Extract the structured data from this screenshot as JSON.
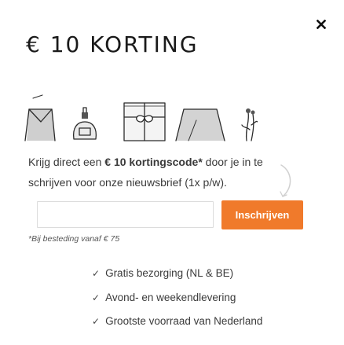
{
  "popup": {
    "close_icon": "close-icon",
    "title": "€ 10 KORTING",
    "illustration": "gift-items-illustration",
    "lead_pre": "Krijg direct een ",
    "lead_bold": "€ 10 kortingscode*",
    "lead_post": " door je in te schrijven voor onze nieuwsbrief (1x p/w).",
    "email_value": "",
    "email_placeholder": "",
    "subscribe_label": "Inschrijven",
    "footnote": "*Bij besteding vanaf € 75",
    "usps": [
      {
        "label": "Gratis bezorging (NL & BE)",
        "icon": "check-icon"
      },
      {
        "label": "Avond- en weekendlevering",
        "icon": "check-icon"
      },
      {
        "label": "Grootste voorraad van Nederland",
        "icon": "check-icon"
      }
    ],
    "colors": {
      "accent": "#f07a2b",
      "text": "#333333",
      "title": "#1a1a1a",
      "border": "#dcdcdc"
    }
  }
}
